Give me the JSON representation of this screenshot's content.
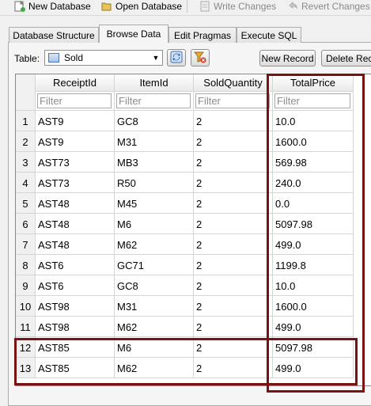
{
  "toolbar": {
    "new_database": "New Database",
    "open_database": "Open Database",
    "write_changes": "Write Changes",
    "revert_changes": "Revert Changes"
  },
  "tabs": [
    {
      "label": "Database Structure"
    },
    {
      "label": "Browse Data",
      "active": true
    },
    {
      "label": "Edit Pragmas"
    },
    {
      "label": "Execute SQL"
    }
  ],
  "table_selector": {
    "label": "Table:",
    "value": "Sold",
    "new_record": "New Record",
    "delete_record": "Delete Reco"
  },
  "grid": {
    "columns": [
      "ReceiptId",
      "ItemId",
      "SoldQuantity",
      "TotalPrice"
    ],
    "filter_placeholder": "Filter",
    "rows": [
      {
        "n": "1",
        "cells": [
          "AST9",
          "GC8",
          "2",
          "10.0"
        ]
      },
      {
        "n": "2",
        "cells": [
          "AST9",
          "M31",
          "2",
          "1600.0"
        ]
      },
      {
        "n": "3",
        "cells": [
          "AST73",
          "MB3",
          "2",
          "569.98"
        ]
      },
      {
        "n": "4",
        "cells": [
          "AST73",
          "R50",
          "2",
          "240.0"
        ]
      },
      {
        "n": "5",
        "cells": [
          "AST48",
          "M45",
          "2",
          "0.0"
        ]
      },
      {
        "n": "6",
        "cells": [
          "AST48",
          "M6",
          "2",
          "5097.98"
        ]
      },
      {
        "n": "7",
        "cells": [
          "AST48",
          "M62",
          "2",
          "499.0"
        ]
      },
      {
        "n": "8",
        "cells": [
          "AST6",
          "GC71",
          "2",
          "1199.8"
        ]
      },
      {
        "n": "9",
        "cells": [
          "AST6",
          "GC8",
          "2",
          "10.0"
        ]
      },
      {
        "n": "10",
        "cells": [
          "AST98",
          "M31",
          "2",
          "1600.0"
        ]
      },
      {
        "n": "11",
        "cells": [
          "AST98",
          "M62",
          "2",
          "499.0"
        ]
      },
      {
        "n": "12",
        "cells": [
          "AST85",
          "M6",
          "2",
          "5097.98"
        ]
      },
      {
        "n": "13",
        "cells": [
          "AST85",
          "M62",
          "2",
          "499.0"
        ]
      }
    ]
  },
  "colors": {
    "highlight": "#7a1212"
  }
}
